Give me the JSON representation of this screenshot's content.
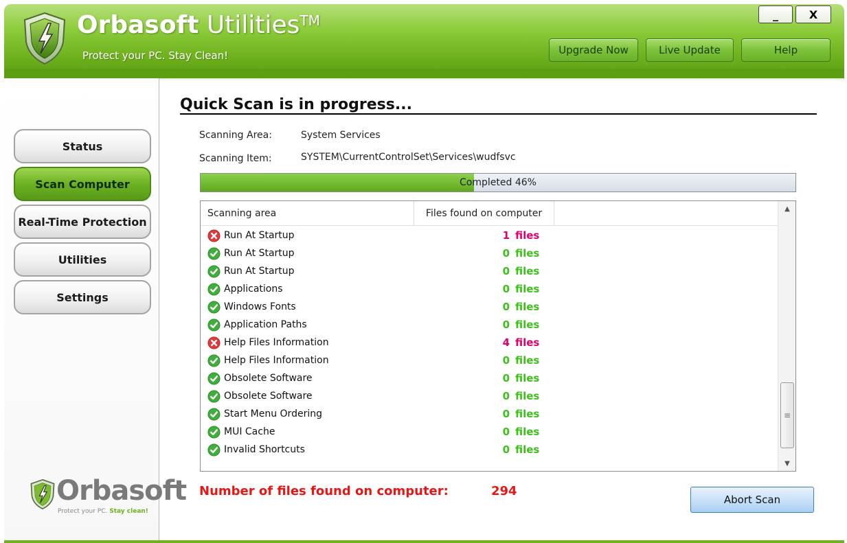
{
  "header": {
    "brand_bold": "Orbasoft",
    "brand_light": " Utilities",
    "brand_tm": "TM",
    "tagline": "Protect your PC. Stay Clean!",
    "buttons": {
      "upgrade": "Upgrade Now",
      "live_update": "Live Update",
      "help": "Help"
    },
    "window_controls": {
      "minimize": "_",
      "close": "X"
    },
    "colors": {
      "header_green": "#6fb21e"
    }
  },
  "sidebar": {
    "items": [
      {
        "label": "Status",
        "active": false
      },
      {
        "label": "Scan Computer",
        "active": true
      },
      {
        "label": "Real-Time Protection",
        "active": false
      },
      {
        "label": "Utilities",
        "active": false
      },
      {
        "label": "Settings",
        "active": false
      }
    ],
    "logo": {
      "word": "Orbasoft",
      "tag_plain": "Protect your PC. ",
      "tag_green": "Stay clean!"
    }
  },
  "main": {
    "title": "Quick Scan is in progress...",
    "scanning_area_label": "Scanning Area:",
    "scanning_area_value": "System Services",
    "scanning_item_label": "Scanning Item:",
    "scanning_item_value": "SYSTEM\\CurrentControlSet\\Services\\wudfsvc",
    "progress": {
      "percent": 46,
      "text": "Completed 46%"
    },
    "list": {
      "columns": {
        "area": "Scanning area",
        "files": "Files found on computer"
      },
      "unit": "files",
      "rows": [
        {
          "name": "Run At Startup",
          "count": "1",
          "status": "bad"
        },
        {
          "name": "Run At Startup",
          "count": "0",
          "status": "ok"
        },
        {
          "name": "Run At Startup",
          "count": "0",
          "status": "ok"
        },
        {
          "name": "Applications",
          "count": "0",
          "status": "ok"
        },
        {
          "name": "Windows Fonts",
          "count": "0",
          "status": "ok"
        },
        {
          "name": "Application Paths",
          "count": "0",
          "status": "ok"
        },
        {
          "name": "Help Files Information",
          "count": "4",
          "status": "bad"
        },
        {
          "name": "Help Files Information",
          "count": "0",
          "status": "ok"
        },
        {
          "name": "Obsolete Software",
          "count": "0",
          "status": "ok"
        },
        {
          "name": "Obsolete Software",
          "count": "0",
          "status": "ok"
        },
        {
          "name": "Start Menu Ordering",
          "count": "0",
          "status": "ok"
        },
        {
          "name": "MUI Cache",
          "count": "0",
          "status": "ok"
        },
        {
          "name": "Invalid Shortcuts",
          "count": "0",
          "status": "ok"
        }
      ]
    },
    "total_label": "Number of files found on computer:",
    "total_value": "294",
    "abort_label": "Abort Scan",
    "colors": {
      "ok": "#3cc01a",
      "bad": "#e0006a",
      "total": "#e81515"
    }
  }
}
